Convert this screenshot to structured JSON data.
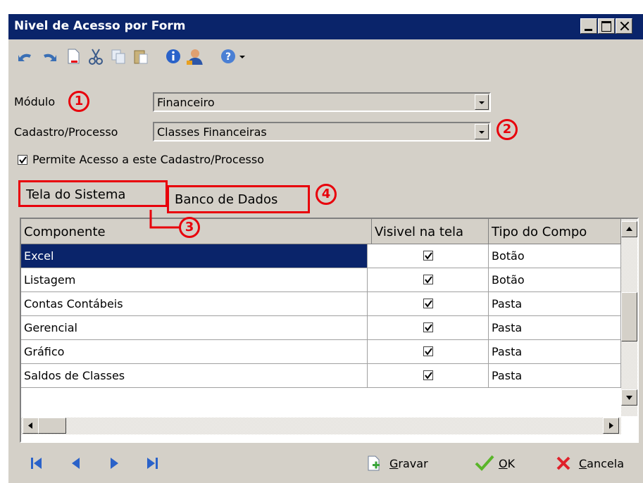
{
  "window": {
    "title": "Nivel de Acesso por Form"
  },
  "toolbar": {
    "icons": [
      "undo-icon",
      "redo-icon",
      "new-icon",
      "cut-icon",
      "copy-icon",
      "paste-icon",
      "info-icon",
      "user-icon",
      "help-icon",
      "dropdown-arrow-icon"
    ]
  },
  "form": {
    "modulo_label": "Módulo",
    "modulo_value": "Financeiro",
    "cadastro_label": "Cadastro/Processo",
    "cadastro_value": "Classes Financeiras",
    "permite_label": "Permite Acesso a este Cadastro/Processo",
    "permite_checked": true
  },
  "annotations": {
    "a1": "1",
    "a2": "2",
    "a3": "3",
    "a4": "4",
    "color": "#e8000b"
  },
  "tabs": [
    {
      "label": "Tela do Sistema",
      "active": true
    },
    {
      "label": "Banco de Dados",
      "active": false
    }
  ],
  "grid": {
    "headers": [
      "Componente",
      "Visivel na tela",
      "Tipo do Compo"
    ],
    "rows": [
      {
        "componente": "Excel",
        "visivel": true,
        "tipo": "Botão",
        "selected": true
      },
      {
        "componente": "Listagem",
        "visivel": true,
        "tipo": "Botão"
      },
      {
        "componente": "Contas Contábeis",
        "visivel": true,
        "tipo": "Pasta"
      },
      {
        "componente": "Gerencial",
        "visivel": true,
        "tipo": "Pasta"
      },
      {
        "componente": "Gráfico",
        "visivel": true,
        "tipo": "Pasta"
      },
      {
        "componente": "Saldos de Classes",
        "visivel": true,
        "tipo": "Pasta"
      }
    ]
  },
  "navigation": {
    "icons": [
      "first-record-icon",
      "prev-record-icon",
      "next-record-icon",
      "last-record-icon"
    ]
  },
  "buttons": {
    "gravar_hot": "G",
    "gravar_rest": "ravar",
    "ok_hot": "O",
    "ok_rest": "K",
    "cancela_hot": "C",
    "cancela_rest": "ancela"
  },
  "colors": {
    "titlebar": "#0a246a",
    "face": "#d4d0c8",
    "selection": "#0a246a",
    "accent_red": "#e8000b"
  }
}
